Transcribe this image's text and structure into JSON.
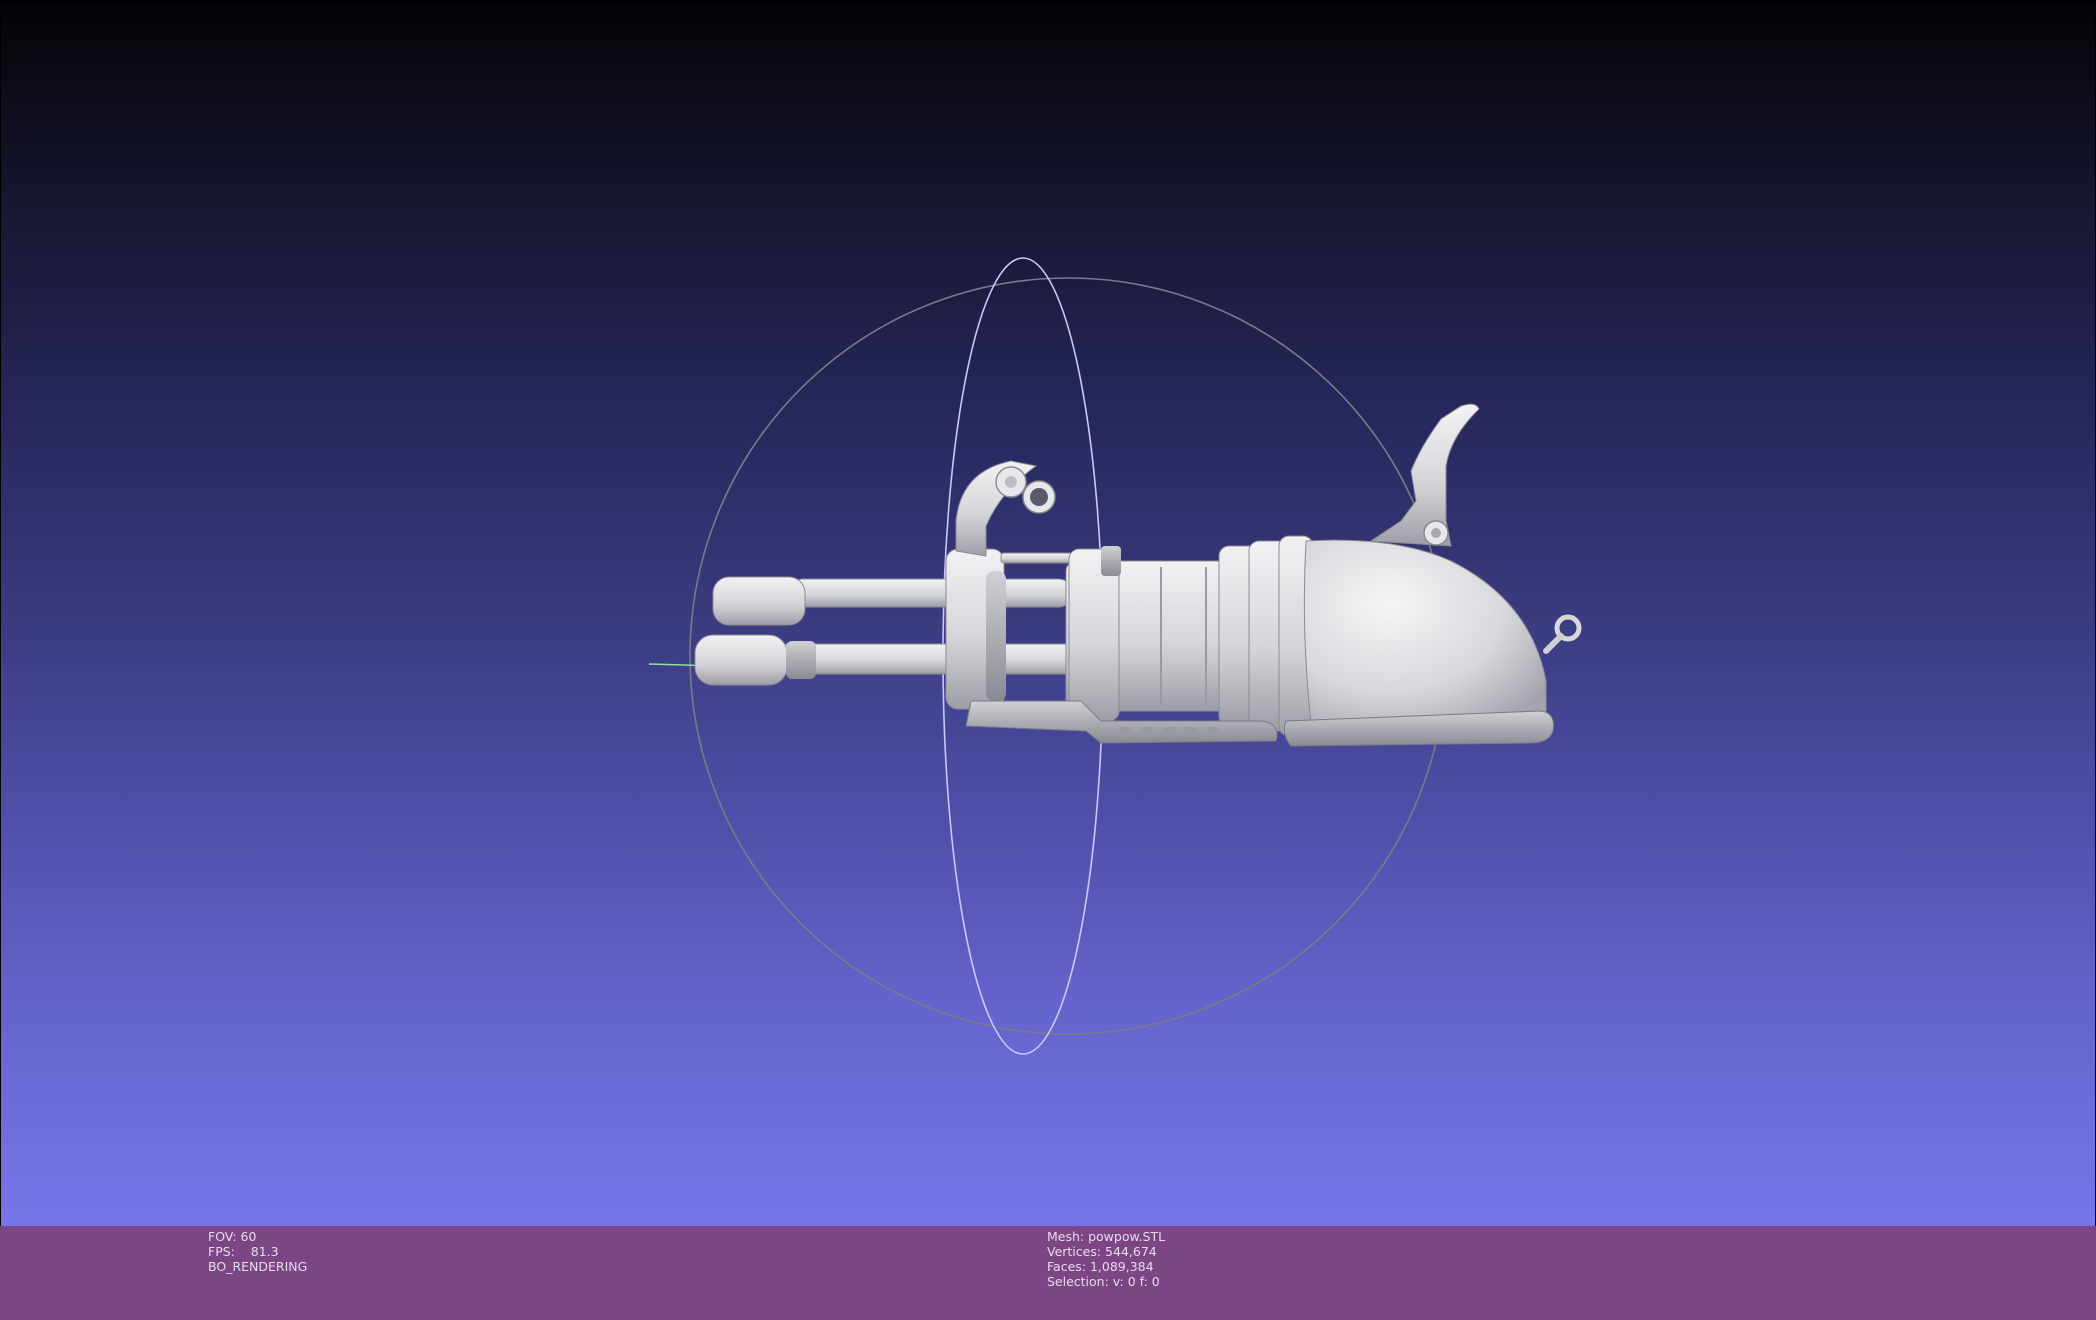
{
  "status_bar": {
    "left": {
      "fov": "FOV: 60",
      "fps": "FPS:    81.3",
      "mode": "BO_RENDERING"
    },
    "right": {
      "mesh": "Mesh: powpow.STL",
      "vertices": "Vertices: 544,674",
      "faces": "Faces: 1,089,384",
      "selection": "Selection: v: 0 f: 0"
    }
  },
  "colors": {
    "background_top": "#030305",
    "background_bottom": "#7676e8",
    "status_bar": "#7c4684",
    "mesh": "#d8d8dc",
    "trackball_ring": "#7a7a8a",
    "trackball_vertical": "#c8c8ff",
    "trackball_horizontal": "#8fe0a0"
  }
}
